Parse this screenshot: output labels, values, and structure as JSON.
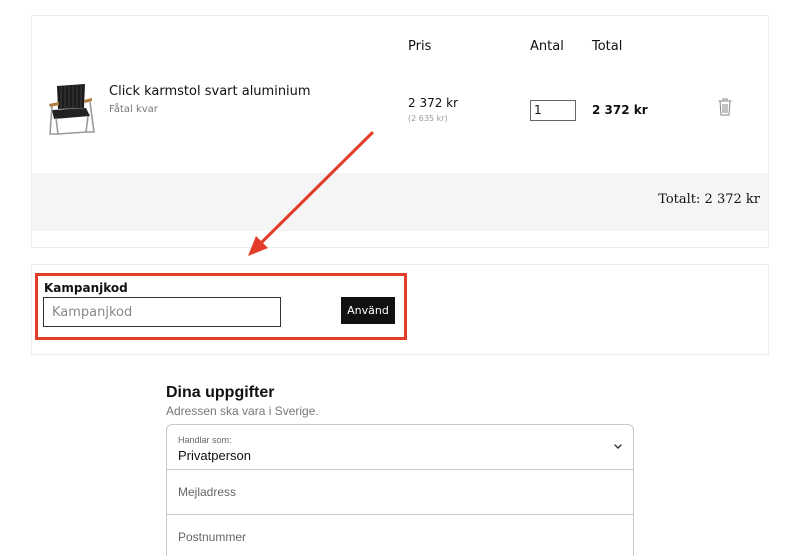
{
  "cart": {
    "columns": {
      "price": "Pris",
      "quantity": "Antal",
      "total": "Total"
    },
    "items": [
      {
        "name": "Click karmstol svart aluminium",
        "stock_status": "Fåtal kvar",
        "price": "2 372 kr",
        "original_price": "(2 635 kr)",
        "quantity": "1",
        "line_total": "2 372 kr",
        "image_icon": "chair-product-image"
      }
    ],
    "grand_total": "Totalt: 2 372 kr"
  },
  "promo": {
    "label": "Kampanjkod",
    "placeholder": "Kampanjkod",
    "apply_label": "Använd",
    "highlight_color": "#e23d28"
  },
  "details": {
    "title": "Dina uppgifter",
    "subtitle": "Adressen ska vara i Sverige.",
    "customer_type_label": "Handlar som:",
    "customer_type_value": "Privatperson",
    "email_placeholder": "Mejladress",
    "postcode_placeholder": "Postnummer"
  },
  "colors": {
    "annotation": "#e23d28",
    "button_bg": "#111111",
    "total_band": "#f5f5f5"
  }
}
